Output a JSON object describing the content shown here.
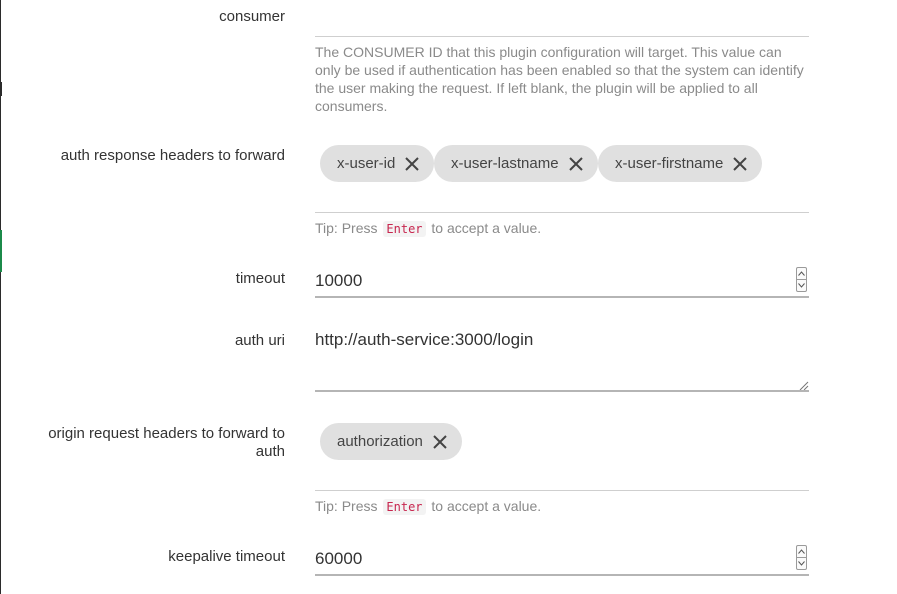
{
  "form": {
    "consumer": {
      "label": "consumer",
      "help": "The CONSUMER ID that this plugin configuration will target. This value can only be used if authentication has been enabled so that the system can identify the user making the request. If left blank, the plugin will be applied to all consumers."
    },
    "auth_response_headers": {
      "label": "auth response headers to forward",
      "chips": [
        "x-user-id",
        "x-user-lastname",
        "x-user-firstname"
      ],
      "tip_prefix": "Tip: Press",
      "tip_key": "Enter",
      "tip_suffix": "to accept a value."
    },
    "timeout": {
      "label": "timeout",
      "value": "10000"
    },
    "auth_uri": {
      "label": "auth uri",
      "value": "http://auth-service:3000/login"
    },
    "origin_request_headers": {
      "label": "origin request headers to forward to auth",
      "chips": [
        "authorization"
      ],
      "tip_prefix": "Tip: Press",
      "tip_key": "Enter",
      "tip_suffix": "to accept a value."
    },
    "keepalive_timeout": {
      "label": "keepalive timeout",
      "value": "60000"
    }
  }
}
